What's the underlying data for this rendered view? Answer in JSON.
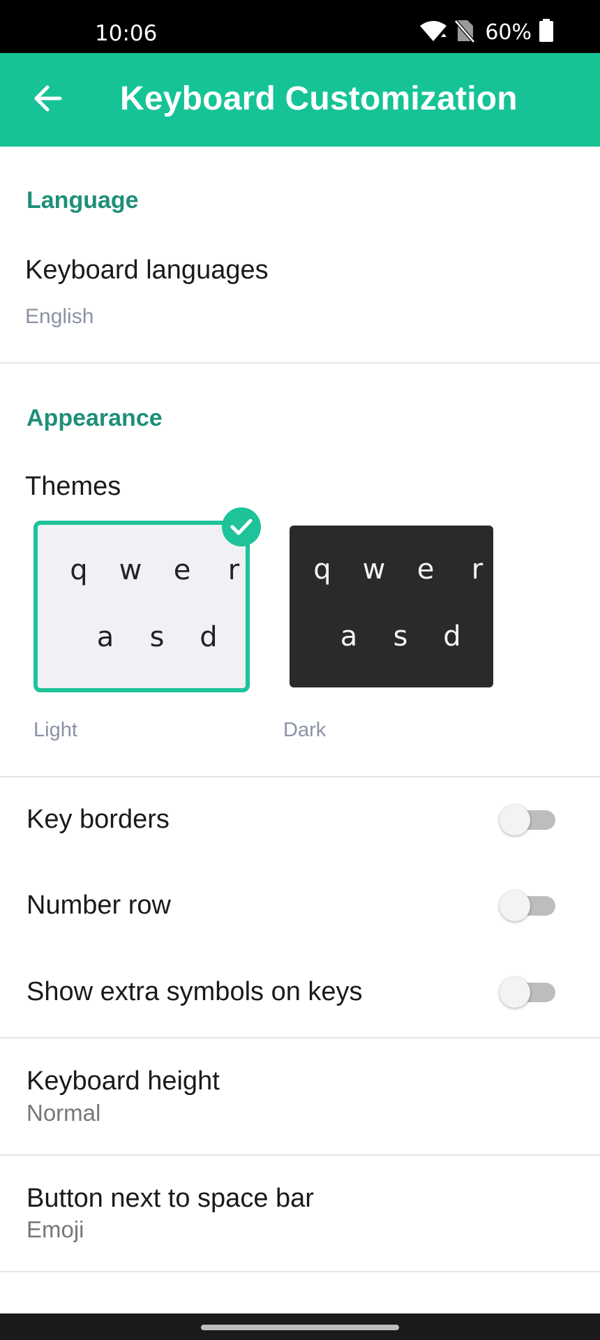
{
  "status_bar": {
    "time": "10:06",
    "battery_text": "60%",
    "icons": [
      "wifi-icon",
      "no-sim-icon",
      "battery-icon"
    ]
  },
  "app_bar": {
    "title": "Keyboard Customization",
    "back_icon": "arrow-left-icon",
    "color": "#16c397"
  },
  "language_section": {
    "header": "Language",
    "keyboard_languages": {
      "title": "Keyboard languages",
      "value": "English"
    }
  },
  "appearance_section": {
    "header": "Appearance",
    "themes_title": "Themes",
    "themes": [
      {
        "label": "Light",
        "selected": true,
        "row1": [
          "q",
          "w",
          "e",
          "r"
        ],
        "row2": [
          "a",
          "s",
          "d"
        ]
      },
      {
        "label": "Dark",
        "selected": false,
        "row1": [
          "q",
          "w",
          "e",
          "r"
        ],
        "row2": [
          "a",
          "s",
          "d"
        ]
      }
    ]
  },
  "toggles": [
    {
      "label": "Key borders",
      "on": false
    },
    {
      "label": "Number row",
      "on": false
    },
    {
      "label": "Show extra symbols on keys",
      "on": false
    }
  ],
  "keyboard_height": {
    "title": "Keyboard height",
    "value": "Normal"
  },
  "space_bar_button": {
    "title": "Button next to space bar",
    "value": "Emoji"
  },
  "colors": {
    "accent": "#1ec39a",
    "section_header": "#1f8f78",
    "dark_theme": "#2a2a2c"
  }
}
